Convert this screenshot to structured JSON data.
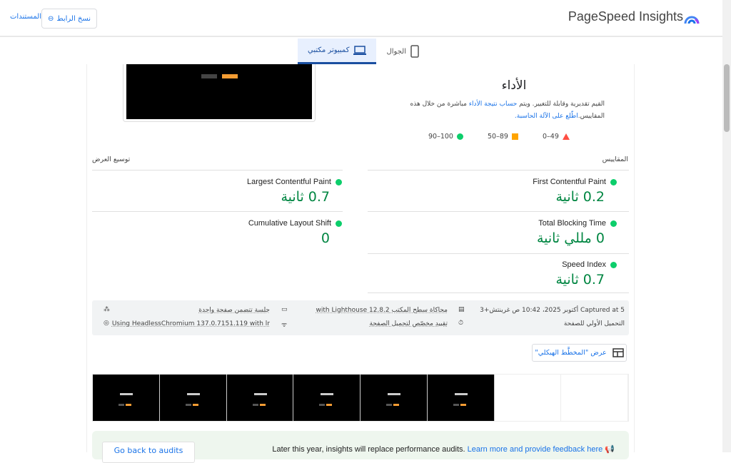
{
  "header": {
    "title": "PageSpeed Insights",
    "copy_link": "نسخ الرابط",
    "docs": "المستندات"
  },
  "tabs": [
    {
      "label": "الجوال"
    },
    {
      "label": "كمبيوتر مكتبي",
      "active": true
    }
  ],
  "performance": {
    "title": "الأداء",
    "desc_1": "القيم تقديرية وقابلة للتغيير. ويتم ",
    "desc_link1": "حساب نتيجة الأداء",
    "desc_2": " مباشرة من خلال هذه المقاييس.",
    "desc_link2": "اطّلع على الآلة الحاسبة."
  },
  "legend": [
    {
      "label": "0–49",
      "color": "#ff4e42"
    },
    {
      "label": "50–89",
      "color": "#ffa400"
    },
    {
      "label": "90–100",
      "color": "#0cce6b"
    }
  ],
  "metrics_label": "المقاييس",
  "expand_view": "توسيع العرض",
  "metrics": [
    {
      "name": "First Contentful Paint",
      "value": "0.2 ثانية"
    },
    {
      "name": "Largest Contentful Paint",
      "value": "0.7 ثانية"
    },
    {
      "name": "Total Blocking Time",
      "value": "0 مللي ثانية"
    },
    {
      "name": "Cumulative Layout Shift",
      "value": "0"
    },
    {
      "name": "Speed Index",
      "value": "0.7 ثانية"
    }
  ],
  "info": {
    "captured": "Captured at 5 أكتوبر 2025، 10:42 ص غرينتش+3",
    "emulation": "محاكاة سطح المكتب with Lighthouse 12.8.2",
    "session": "جلسة تتضمن صفحة واحدة",
    "initial_load": "التحميل الأولي للصفحة",
    "throttling": "تقييد مخصّص لتحميل الصفحة",
    "browser": "Using HeadlessChromium 137.0.7151.119 with lr"
  },
  "treemap_button": "عرض \"المخطَّط الهيكلي\"",
  "notice": {
    "text": "Later this year, insights will replace performance audits. ",
    "link": "Learn more and provide feedback here",
    "back": "Go back to audits"
  }
}
